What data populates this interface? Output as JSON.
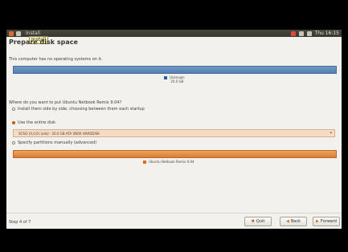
{
  "topbar": {
    "window_title": "Install",
    "clock": "Thu 16:15"
  },
  "tooltip": "Install",
  "installer": {
    "title": "Prepare disk space",
    "info_text": "This computer has no operating systems on it.",
    "disk_legend": {
      "label": "Unknown",
      "size": "20.0 GB",
      "color": "#2f5f9e"
    },
    "question": "Where do you want to put Ubuntu Netbook Remix 9.04?",
    "install_side_by_side": "Install them side by side, choosing between them each startup",
    "use_entire_disk": "Use the entire disk",
    "selected_drive": "SCSI3 (0,0,0) (sda) - 20.0 GB ATA VBOX HARDDISK",
    "specify_manually": "Specify partitions manually (advanced)",
    "target_legend": {
      "label": "Ubuntu Netbook Remix 9.04",
      "color": "#d86b26"
    },
    "step": "Step 4 of 7",
    "buttons": {
      "quit": "Quit",
      "back": "Back",
      "forward": "Forward"
    }
  },
  "colors": {
    "accent": "#d86b26",
    "disk_bar": "#6f97c6",
    "highlight": "#f6dcc5"
  }
}
